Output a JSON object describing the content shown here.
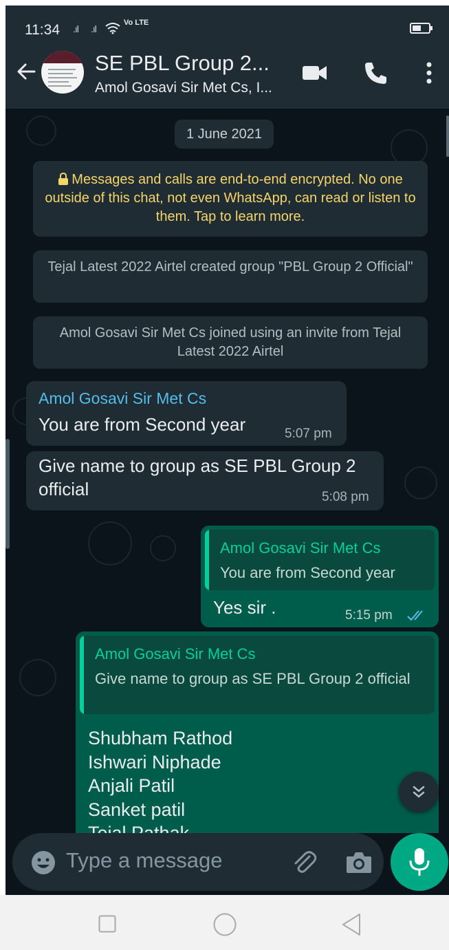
{
  "status_bar": {
    "time": "11:34",
    "network": "Vo LTE",
    "signal_icons": [
      "signal-icon",
      "signal-icon",
      "wifi-icon"
    ],
    "battery_icon": "battery-icon"
  },
  "header": {
    "title": "SE PBL Group 2...",
    "subtitle": "Amol Gosavi Sir Met Cs, I...",
    "icons": [
      "back-arrow-icon",
      "video-call-icon",
      "voice-call-icon",
      "more-options-icon"
    ]
  },
  "chat": {
    "date_chip": "1 June 2021",
    "encryption_notice": "Messages and calls are end-to-end encrypted. No one outside of this chat, not even WhatsApp, can read or listen to them. Tap to learn more.",
    "system_messages": [
      "Tejal Latest 2022 Airtel created group \"PBL Group 2 Official\"",
      "Amol Gosavi Sir Met Cs joined using an invite from Tejal Latest 2022 Airtel"
    ],
    "messages": [
      {
        "direction": "in",
        "sender": "Amol Gosavi Sir Met Cs",
        "text": "You are from Second year",
        "time": "5:07 pm"
      },
      {
        "direction": "in",
        "text": "Give name to group as SE PBL Group 2 official",
        "time": "5:08 pm"
      },
      {
        "direction": "out",
        "quote_sender": "Amol Gosavi Sir Met Cs",
        "quote_text": "You are from Second year",
        "text": "Yes sir .",
        "time": "5:15 pm",
        "status": "read"
      },
      {
        "direction": "out",
        "quote_sender": "Amol Gosavi Sir Met Cs",
        "quote_text": "Give name to group as SE PBL Group 2 official",
        "lines": [
          "Shubham Rathod",
          "Ishwari Niphade",
          "Anjali Patil",
          "Sanket patil",
          "Tejal Pathak"
        ]
      }
    ]
  },
  "composer": {
    "placeholder": "Type a message",
    "icons": [
      "emoji-icon",
      "attach-icon",
      "camera-icon",
      "mic-icon"
    ]
  },
  "colors": {
    "header_bg": "#1f2c33",
    "chat_bg": "#0b141a",
    "incoming_bubble": "#1f2c33",
    "outgoing_bubble": "#005c4b",
    "accent": "#00a884",
    "sender_name": "#53bdeb",
    "encryption_text": "#f5d469"
  }
}
